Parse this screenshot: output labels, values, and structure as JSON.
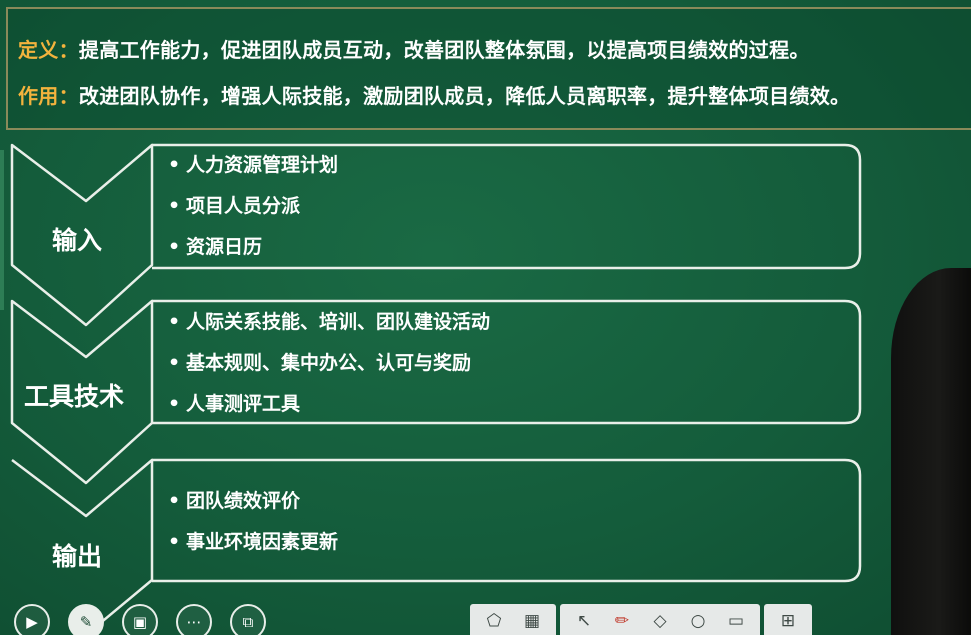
{
  "definition": {
    "label": "定义：",
    "text": "提高工作能力，促进团队成员互动，改善团队整体氛围，以提高项目绩效的过程。"
  },
  "purpose": {
    "label": "作用：",
    "text": "改进团队协作，增强人际技能，激励团队成员，降低人员离职率，提升整体项目绩效。"
  },
  "stages": [
    {
      "label": "输入",
      "items": [
        "人力资源管理计划",
        "项目人员分派",
        "资源日历"
      ]
    },
    {
      "label": "工具技术",
      "items": [
        "人际关系技能、培训、团队建设活动",
        "基本规则、集中办公、认可与奖励",
        "人事测评工具"
      ]
    },
    {
      "label": "输出",
      "items": [
        "团队绩效评价",
        "事业环境因素更新"
      ]
    }
  ],
  "bullet": "•",
  "colors": {
    "board": "#135e3c",
    "label_accent": "#f3b33d",
    "line": "#e9efe9",
    "frame": "#8a8a5a"
  },
  "toolbar": {
    "left": [
      "play-icon",
      "pen-icon",
      "slide-icon",
      "more-icon",
      "screen-icon"
    ],
    "right": [
      "shape-icon",
      "qr-icon",
      "pointer-icon",
      "red-pen-icon",
      "eraser-icon",
      "search-icon",
      "board-icon",
      "grid-icon"
    ]
  }
}
